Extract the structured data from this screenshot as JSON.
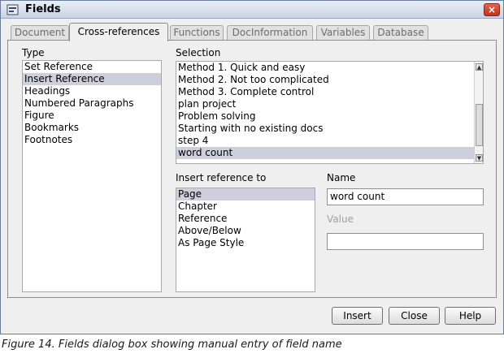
{
  "window": {
    "title": "Fields",
    "close_label": "×"
  },
  "tabs": [
    {
      "label": "Document",
      "active": false
    },
    {
      "label": "Cross-references",
      "active": true
    },
    {
      "label": "Functions",
      "active": false
    },
    {
      "label": "DocInformation",
      "active": false
    },
    {
      "label": "Variables",
      "active": false
    },
    {
      "label": "Database",
      "active": false
    }
  ],
  "type": {
    "label": "Type",
    "items": [
      "Set Reference",
      "Insert Reference",
      "Headings",
      "Numbered Paragraphs",
      "Figure",
      "Bookmarks",
      "Footnotes"
    ],
    "selected_index": 1
  },
  "selection": {
    "label": "Selection",
    "items": [
      "Method 1. Quick and easy",
      "Method 2. Not too complicated",
      "Method 3. Complete control",
      "plan project",
      "Problem solving",
      "Starting with no existing docs",
      "step 4",
      "word count"
    ],
    "selected_index": 7
  },
  "insert_reference": {
    "label": "Insert reference to",
    "items": [
      "Page",
      "Chapter",
      "Reference",
      "Above/Below",
      "As Page Style"
    ],
    "selected_index": 0
  },
  "name": {
    "label": "Name",
    "value": "word count"
  },
  "value": {
    "label": "Value",
    "value": ""
  },
  "buttons": {
    "insert": "Insert",
    "close": "Close",
    "help": "Help"
  },
  "caption": "Figure 14. Fields dialog box showing manual entry of field name"
}
